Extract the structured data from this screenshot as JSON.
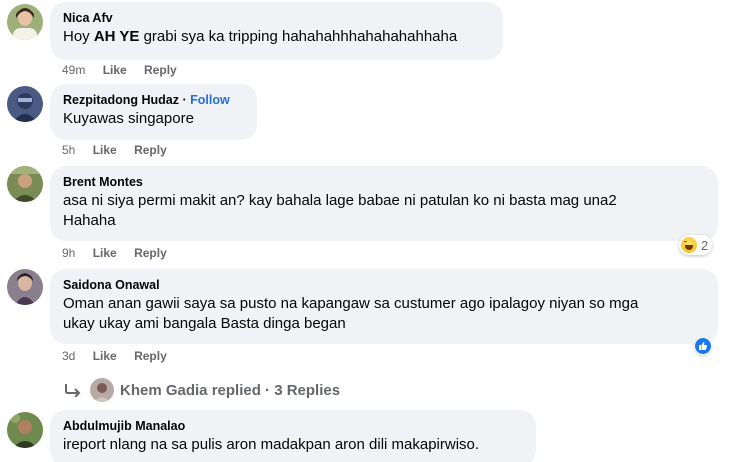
{
  "comments": [
    {
      "author": "Nica Afv",
      "text_prefix": "Hoy ",
      "text_bold": "AH YE",
      "text_suffix": " grabi sya ka tripping hahahahhhahahahahhaha",
      "time": "49m",
      "like": "Like",
      "reply": "Reply"
    },
    {
      "author": "Rezpitadong Hudaz",
      "separator": "·",
      "follow": "Follow",
      "text": "Kuyawas singapore",
      "time": "5h",
      "like": "Like",
      "reply": "Reply"
    },
    {
      "author": "Brent Montes",
      "text_line1": "asa ni siya permi makit an? kay bahala lage babae ni patulan ko ni basta mag una2",
      "text_line2": "Hahaha",
      "time": "9h",
      "like": "Like",
      "reply": "Reply",
      "reaction_count": "2",
      "reaction_icon": "haha-emoji-icon"
    },
    {
      "author": "Saidona Onawal",
      "text_line1": "Oman anan gawii saya sa pusto na kapangaw sa custumer ago ipalagoy niyan so mga",
      "text_line2": "ukay ukay ami bangala Basta dinga began",
      "time": "3d",
      "like": "Like",
      "reply": "Reply",
      "reaction_icon": "like-thumb-icon"
    },
    {
      "author": "Abdulmujib Manalao",
      "text": "ireport nlang na sa pulis aron madakpan aron dili makapirwiso."
    }
  ],
  "replies_summary": {
    "text": "Khem Gadia replied · 3 Replies"
  },
  "colors": {
    "bubble": "#f0f2f5",
    "link_blue": "#216fdb",
    "meta_gray": "#65676b",
    "like_blue": "#1877f2"
  }
}
